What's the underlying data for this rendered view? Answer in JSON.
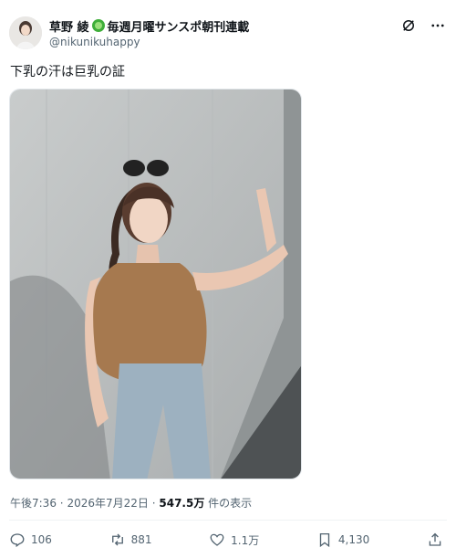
{
  "author": {
    "display_name": "草野 綾",
    "name_suffix": "毎週月曜サンスポ朝刊連載",
    "handle": "@nikunikuhappy",
    "badge_icon": "green-circle-badge"
  },
  "tweet": {
    "text": "下乳の汗は巨乳の証"
  },
  "meta": {
    "time": "午後7:36",
    "separator": "·",
    "date": "2026年7月22日",
    "views_count": "547.5万",
    "views_label": "件の表示"
  },
  "actions": {
    "reply_count": "106",
    "repost_count": "881",
    "like_count": "1.1万",
    "bookmark_count": "4,130"
  },
  "colors": {
    "text": "#0f1419",
    "muted": "#536471",
    "border": "#eff3f4"
  }
}
